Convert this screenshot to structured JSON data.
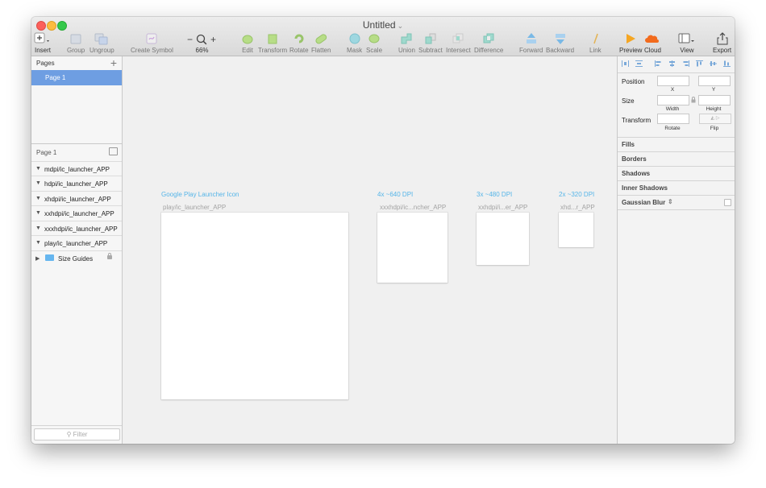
{
  "window": {
    "title": "Untitled"
  },
  "toolbar": {
    "insert": "Insert",
    "group": "Group",
    "ungroup": "Ungroup",
    "create_symbol": "Create Symbol",
    "zoom_value": "66%",
    "zoom_minus": "−",
    "zoom_plus": "+",
    "edit": "Edit",
    "transform": "Transform",
    "rotate": "Rotate",
    "flatten": "Flatten",
    "mask": "Mask",
    "scale": "Scale",
    "union": "Union",
    "subtract": "Subtract",
    "intersect": "Intersect",
    "difference": "Difference",
    "forward": "Forward",
    "backward": "Backward",
    "link": "Link",
    "preview": "Preview",
    "cloud": "Cloud",
    "view": "View",
    "export": "Export"
  },
  "pages_panel": {
    "header": "Pages",
    "add_symbol": "+",
    "pages": [
      "Page 1"
    ]
  },
  "layers_panel": {
    "header": "Page 1",
    "layers": [
      "mdpi/ic_launcher_APP",
      "hdpi/ic_launcher_APP",
      "xhdpi/ic_launcher_APP",
      "xxhdpi/ic_launcher_APP",
      "xxxhdpi/ic_launcher_APP",
      "play/ic_launcher_APP",
      "Size Guides"
    ],
    "filter_placeholder": "Filter"
  },
  "canvas": {
    "artboards": [
      {
        "label": "Google Play Launcher Icon",
        "sublabel": "play/ic_launcher_APP"
      },
      {
        "label": "4x ~640 DPI",
        "sublabel": "xxxhdpi/ic...ncher_APP"
      },
      {
        "label": "3x ~480 DPI",
        "sublabel": "xxhdpi/i...er_APP"
      },
      {
        "label": "2x ~320 DPI",
        "sublabel": "xhd...r_APP"
      }
    ]
  },
  "inspector": {
    "position": "Position",
    "x": "X",
    "y": "Y",
    "size": "Size",
    "width": "Width",
    "height": "Height",
    "transform": "Transform",
    "rotate": "Rotate",
    "flip": "Flip",
    "sections": [
      "Fills",
      "Borders",
      "Shadows",
      "Inner Shadows",
      "Gaussian Blur"
    ]
  },
  "colors": {
    "accent": "#6e9ee2",
    "artboard_label": "#56b5e8",
    "preview_orange": "#f5a623",
    "cloud_orange": "#f26b1d"
  }
}
